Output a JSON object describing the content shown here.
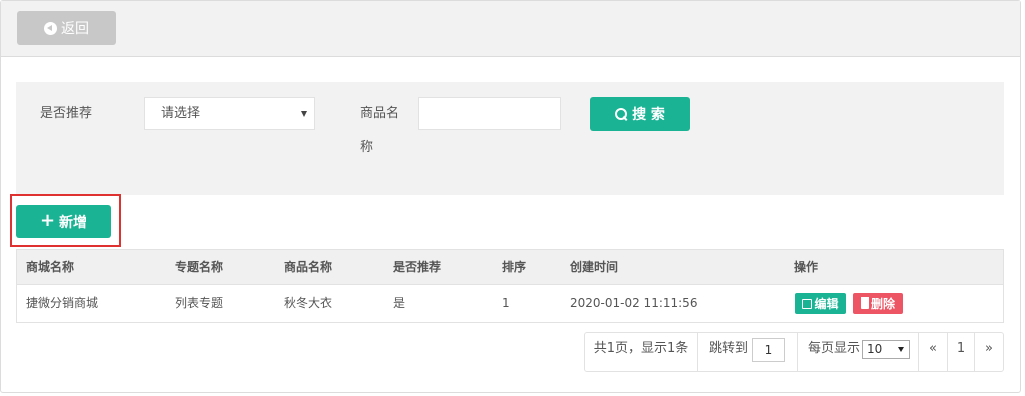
{
  "toolbar": {
    "back_label": "返回"
  },
  "filter": {
    "recommend_label": "是否推荐",
    "recommend_select": "请选择",
    "product_label_line1": "商品名",
    "product_label_line2": "称",
    "product_input_value": "",
    "search_label": "搜 索"
  },
  "actions": {
    "add_label": "新增"
  },
  "table": {
    "headers": [
      "商城名称",
      "专题名称",
      "商品名称",
      "是否推荐",
      "排序",
      "创建时间",
      "操作"
    ],
    "rows": [
      {
        "mall": "捷微分销商城",
        "topic": "列表专题",
        "product": "秋冬大衣",
        "recommended": "是",
        "sort": "1",
        "created": "2020-01-02 11:11:56",
        "edit": "编辑",
        "delete": "删除"
      }
    ]
  },
  "pagination": {
    "info": "共1页，显示1条",
    "jump_label": "跳转到",
    "jump_value": "1",
    "page_size_label": "每页显示",
    "page_size_value": "10",
    "prev": "«",
    "current_page": "1",
    "next": "»"
  },
  "colors": {
    "primary": "#1ab394",
    "danger": "#ed5565",
    "highlight_border": "#e03131",
    "back_button": "#c8c8c8"
  }
}
